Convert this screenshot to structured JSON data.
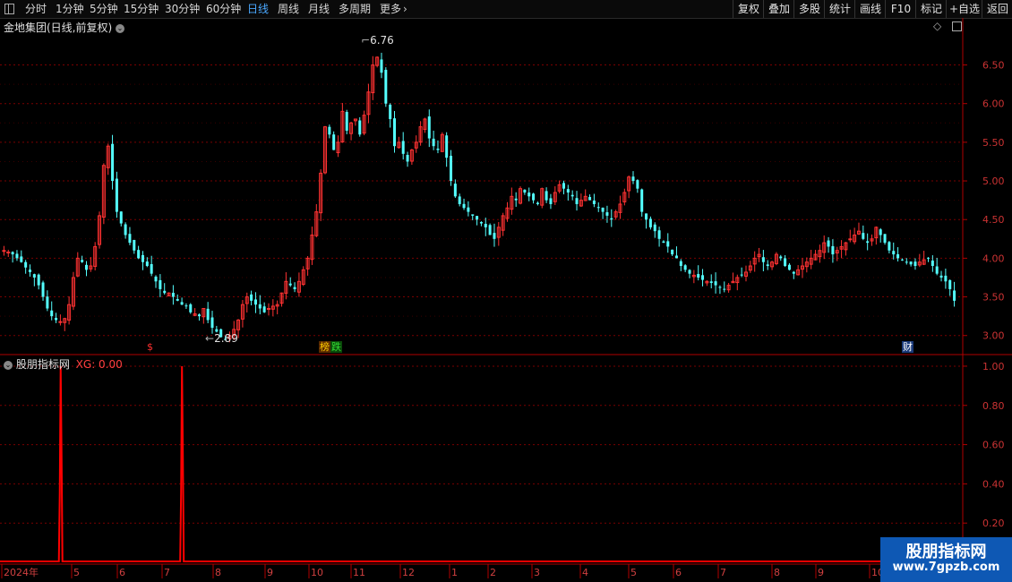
{
  "toolbar": {
    "periods": [
      {
        "label": "分时",
        "active": false
      },
      {
        "label": "1分钟",
        "active": false
      },
      {
        "label": "5分钟",
        "active": false
      },
      {
        "label": "15分钟",
        "active": false
      },
      {
        "label": "30分钟",
        "active": false
      },
      {
        "label": "60分钟",
        "active": false
      },
      {
        "label": "日线",
        "active": true
      },
      {
        "label": "周线",
        "active": false
      },
      {
        "label": "月线",
        "active": false
      },
      {
        "label": "多周期",
        "active": false
      },
      {
        "label": "更多",
        "active": false
      }
    ],
    "right_buttons": [
      "复权",
      "叠加",
      "多股",
      "统计",
      "画线",
      "F10",
      "标记",
      "+自选",
      "返回"
    ]
  },
  "main_panel": {
    "title": "金地集团(日线,前复权)",
    "high_label": "6.76",
    "low_label": "2.89",
    "price_ticks": [
      "6.50",
      "6.00",
      "5.50",
      "5.00",
      "4.50",
      "4.00",
      "3.50",
      "3.00"
    ],
    "event_markers": [
      {
        "text": "$",
        "color": "#ff3030"
      },
      {
        "text": "榜",
        "color": "#ffcc00"
      },
      {
        "text": "跌",
        "color": "#33dd33"
      },
      {
        "text": "财",
        "color": "#ffffff"
      }
    ]
  },
  "indicator_panel": {
    "name": "股朋指标网",
    "value_label": "XG: 0.00",
    "ticks": [
      "1.00",
      "0.80",
      "0.60",
      "0.40",
      "0.20"
    ]
  },
  "date_axis": [
    "2024年",
    "5",
    "6",
    "7",
    "8",
    "9",
    "10",
    "11",
    "12",
    "1",
    "2",
    "3",
    "4",
    "5",
    "6",
    "7",
    "8",
    "9",
    "10"
  ],
  "watermark": {
    "line1": "股朋指标网",
    "line2": "www.7gpzb.com"
  },
  "colors": {
    "up": "#ff3232",
    "down": "#54ffff",
    "grid": "#7a0000",
    "axis": "#b00000",
    "signal": "#ff0000"
  },
  "chart_data": {
    "type": "candlestick",
    "ylim": [
      2.8,
      6.9
    ],
    "high": 6.76,
    "low": 2.89,
    "series_close": [
      4.1,
      4.08,
      4.05,
      4.0,
      3.95,
      3.88,
      3.82,
      3.75,
      3.65,
      3.5,
      3.35,
      3.25,
      3.2,
      3.18,
      3.22,
      3.4,
      3.75,
      4.0,
      3.95,
      3.85,
      3.9,
      4.15,
      4.55,
      5.2,
      5.45,
      5.0,
      4.6,
      4.45,
      4.3,
      4.2,
      4.1,
      4.0,
      3.95,
      3.9,
      3.8,
      3.7,
      3.6,
      3.55,
      3.55,
      3.5,
      3.45,
      3.4,
      3.38,
      3.3,
      3.28,
      3.25,
      3.35,
      3.2,
      3.1,
      3.05,
      2.98,
      2.95,
      3.0,
      3.08,
      3.2,
      3.4,
      3.5,
      3.45,
      3.4,
      3.35,
      3.3,
      3.35,
      3.38,
      3.4,
      3.55,
      3.7,
      3.65,
      3.6,
      3.7,
      3.85,
      4.0,
      4.3,
      4.6,
      5.1,
      5.7,
      5.6,
      5.4,
      5.5,
      5.9,
      5.65,
      5.75,
      5.8,
      5.6,
      5.85,
      6.15,
      6.5,
      6.6,
      6.4,
      6.0,
      5.8,
      5.45,
      5.5,
      5.35,
      5.25,
      5.4,
      5.5,
      5.7,
      5.8,
      5.55,
      5.45,
      5.4,
      5.6,
      5.3,
      5.0,
      4.8,
      4.7,
      4.65,
      4.6,
      4.55,
      4.5,
      4.45,
      4.4,
      4.3,
      4.25,
      4.4,
      4.55,
      4.65,
      4.8,
      4.75,
      4.9,
      4.85,
      4.8,
      4.75,
      4.7,
      4.9,
      4.75,
      4.7,
      4.85,
      4.95,
      4.9,
      4.85,
      4.8,
      4.7,
      4.75,
      4.8,
      4.75,
      4.7,
      4.65,
      4.6,
      4.55,
      4.5,
      4.6,
      4.7,
      4.85,
      5.05,
      5.0,
      4.9,
      4.6,
      4.5,
      4.4,
      4.35,
      4.25,
      4.2,
      4.15,
      4.05,
      4.0,
      3.9,
      3.85,
      3.8,
      3.78,
      3.75,
      3.72,
      3.7,
      3.68,
      3.65,
      3.62,
      3.6,
      3.65,
      3.7,
      3.75,
      3.78,
      3.82,
      3.9,
      4.0,
      4.05,
      3.95,
      3.9,
      3.95,
      4.05,
      4.0,
      3.9,
      3.85,
      3.8,
      3.85,
      3.9,
      3.95,
      4.0,
      4.05,
      4.1,
      4.2,
      4.15,
      4.05,
      4.1,
      4.15,
      4.2,
      4.25,
      4.3,
      4.35,
      4.25,
      4.2,
      4.25,
      4.4,
      4.3,
      4.2,
      4.1,
      4.05,
      4.0,
      3.98,
      3.95,
      3.92,
      3.9,
      3.95,
      3.98,
      4.0,
      3.9,
      3.8,
      3.75,
      3.7,
      3.6,
      3.45
    ],
    "indicator": {
      "name": "XG",
      "signal_positions": [
        0.063,
        0.189
      ],
      "value": 0.0,
      "ylim": [
        0,
        1.05
      ]
    }
  }
}
